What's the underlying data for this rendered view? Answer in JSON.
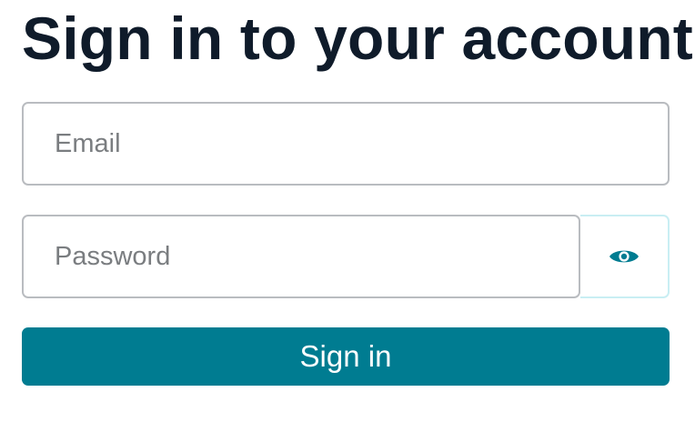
{
  "form": {
    "title": "Sign in to your account",
    "email": {
      "value": "",
      "placeholder": "Email"
    },
    "password": {
      "value": "",
      "placeholder": "Password"
    },
    "toggle_icon": "eye-icon",
    "submit_label": "Sign in"
  },
  "colors": {
    "title_text": "#0f1b2a",
    "accent": "#007c91",
    "input_border": "#b9bcc0",
    "toggle_border": "#c9eef3",
    "placeholder": "#7a7d80"
  }
}
